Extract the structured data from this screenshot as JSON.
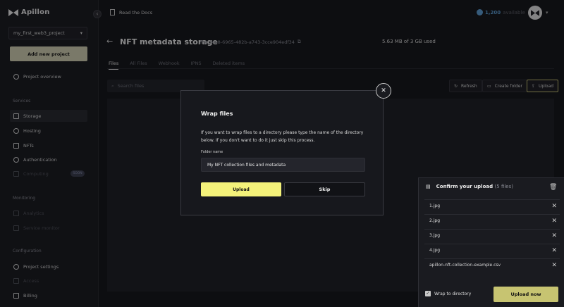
{
  "app": {
    "name": "Apillon"
  },
  "sidebar": {
    "project": "my_first_web3_project",
    "add_project": "Add new project",
    "overview": "Project overview",
    "services_label": "Services",
    "services": [
      "Storage",
      "Hosting",
      "NFTs",
      "Authentication",
      "Computing"
    ],
    "computing_badge": "SOON",
    "monitoring_label": "Monitoring",
    "monitoring": [
      "Analytics",
      "Service monitor"
    ],
    "configuration_label": "Configuration",
    "configuration": [
      "Project settings",
      "Access",
      "Billing"
    ]
  },
  "topbar": {
    "docs": "Read the Docs",
    "credits": "1,200",
    "credits_suffix": "available"
  },
  "page": {
    "title": "NFT metadata storage",
    "uuid": "ff4cd408-6965-482b-a743-3cce904edf34",
    "usage": "5.63 MB of 3 GB used",
    "tabs": [
      "Files",
      "All Files",
      "Webhook",
      "IPNS",
      "Deleted items"
    ],
    "search_placeholder": "Search files",
    "refresh": "Refresh",
    "create_folder": "Create folder",
    "upload": "Upload"
  },
  "modal": {
    "title": "Wrap files",
    "text": "If you want to wrap files to a directory please type the name of the directory below. If you don't want to do it just skip this process.",
    "field_label": "Folder name",
    "field_value": "My NFT collection files and metadata",
    "upload": "Upload",
    "skip": "Skip"
  },
  "upload_panel": {
    "title": "Confirm your upload",
    "count": "(5 files)",
    "files": [
      "1.jpg",
      "2.jpg",
      "3.jpg",
      "4.jpg",
      "apillon-nft-collection-example.csv"
    ],
    "wrap_label": "Wrap to directory",
    "upload_now": "Upload now"
  },
  "colors": {
    "accent": "#f4f27a",
    "accent_muted": "#c7c471",
    "bg": "#121316",
    "link": "#5c9fd8"
  }
}
